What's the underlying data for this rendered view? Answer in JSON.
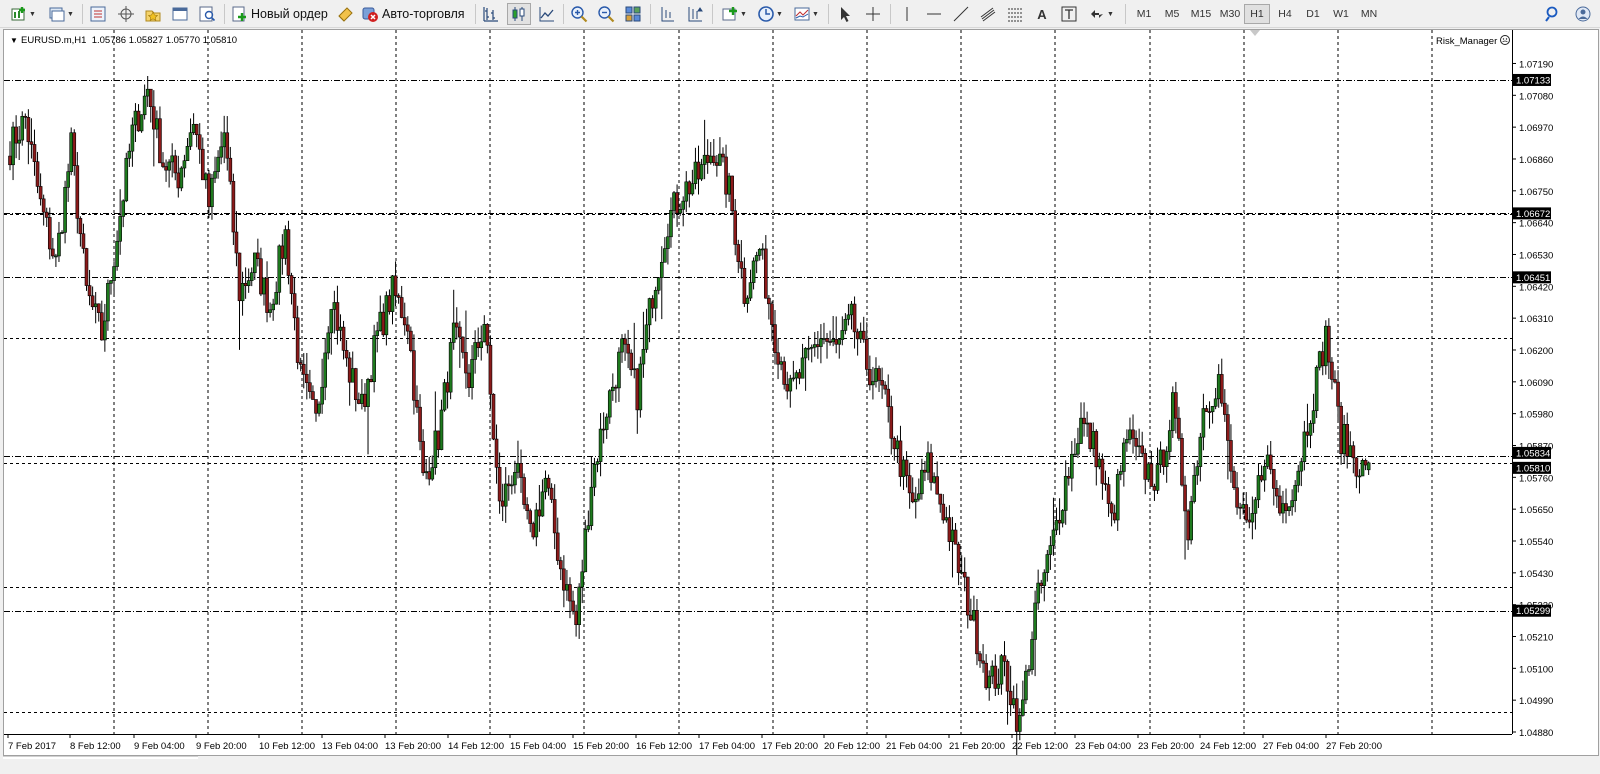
{
  "toolbar": {
    "new_order_label": "Новый ордер",
    "auto_trading_label": "Авто-торговля",
    "timeframes": [
      "M1",
      "M5",
      "M15",
      "M30",
      "H1",
      "H4",
      "D1",
      "W1",
      "MN"
    ],
    "active_timeframe": "H1"
  },
  "chart": {
    "info_line": "EURUSD.m,H1  1.05786 1.05827 1.05770 1.05810",
    "indicator_label": "Risk_Manager",
    "colors": {
      "bull": "#1e7a1e",
      "bear": "#8b1a1a",
      "grid": "#000000",
      "background": "#ffffff"
    }
  },
  "chart_data": {
    "type": "candlestick",
    "symbol": "EURUSD.m",
    "timeframe": "H1",
    "ylim": [
      1.0488,
      1.0724
    ],
    "y_ticks": [
      "1.07190",
      "1.07080",
      "1.06970",
      "1.06860",
      "1.06750",
      "1.06640",
      "1.06530",
      "1.06420",
      "1.06310",
      "1.06200",
      "1.06090",
      "1.05980",
      "1.05870",
      "1.05760",
      "1.05650",
      "1.05540",
      "1.05430",
      "1.05320",
      "1.05210",
      "1.05100",
      "1.04990",
      "1.04880"
    ],
    "x_labels": [
      "7 Feb 2017",
      "8 Feb 12:00",
      "9 Feb 04:00",
      "9 Feb 20:00",
      "10 Feb 12:00",
      "13 Feb 04:00",
      "13 Feb 20:00",
      "14 Feb 12:00",
      "15 Feb 04:00",
      "15 Feb 20:00",
      "16 Feb 12:00",
      "17 Feb 04:00",
      "17 Feb 20:00",
      "20 Feb 12:00",
      "21 Feb 04:00",
      "21 Feb 20:00",
      "22 Feb 12:00",
      "23 Feb 04:00",
      "23 Feb 20:00",
      "24 Feb 12:00",
      "27 Feb 04:00",
      "27 Feb 20:00"
    ],
    "horizontal_lines": [
      "1.07133",
      "1.06672",
      "1.06451",
      "1.05834",
      "1.05299"
    ],
    "current_price": "1.05810",
    "last_ohlc": {
      "open": 1.05786,
      "high": 1.05827,
      "low": 1.0577,
      "close": 1.0581
    },
    "path_close": [
      1.069,
      1.07,
      1.067,
      1.065,
      1.069,
      1.064,
      1.0625,
      1.066,
      1.0695,
      1.071,
      1.0685,
      1.068,
      1.07,
      1.067,
      1.0695,
      1.064,
      1.065,
      1.0635,
      1.066,
      1.061,
      1.0595,
      1.064,
      1.0615,
      1.06,
      1.0625,
      1.064,
      1.063,
      1.0575,
      1.059,
      1.0625,
      1.061,
      1.063,
      1.0565,
      1.058,
      1.0555,
      1.0575,
      1.0545,
      1.0525,
      1.0575,
      1.06,
      1.062,
      1.0605,
      1.064,
      1.0665,
      1.0675,
      1.068,
      1.069,
      1.0675,
      1.064,
      1.0655,
      1.0625,
      1.0605,
      1.0615,
      1.0625,
      1.062,
      1.063,
      1.0615,
      1.0605,
      1.0585,
      1.0565,
      1.058,
      1.0565,
      1.0545,
      1.0525,
      1.0505,
      1.051,
      1.049,
      1.053,
      1.055,
      1.0575,
      1.0595,
      1.0585,
      1.056,
      1.059,
      1.058,
      1.0575,
      1.06,
      1.056,
      1.06,
      1.061,
      1.057,
      1.0555,
      1.0585,
      1.0565,
      1.0575,
      1.06,
      1.0625,
      1.059,
      1.0582
    ],
    "candles_per_step": 5,
    "candle_count": 445
  }
}
